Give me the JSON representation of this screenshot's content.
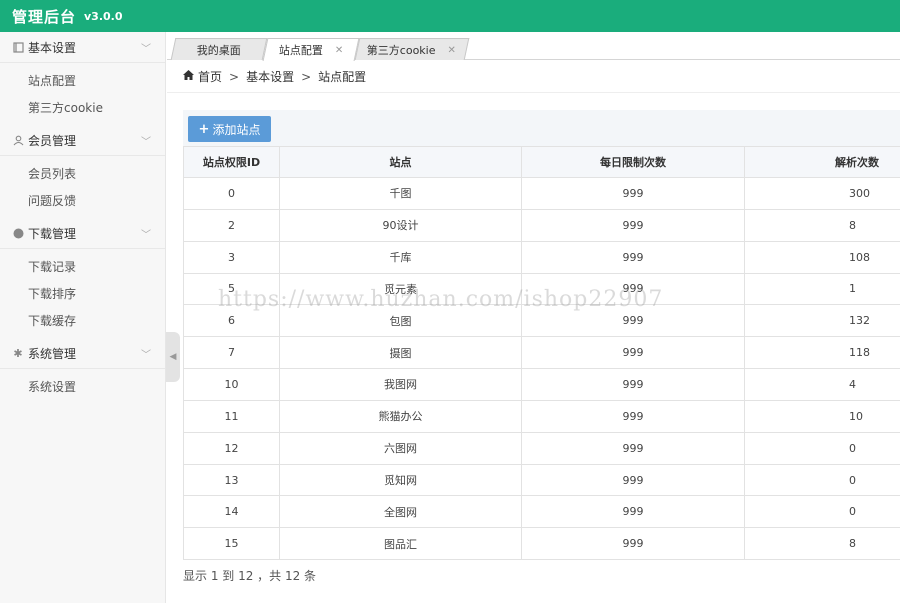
{
  "header": {
    "title": "管理后台",
    "version": "v3.0.0"
  },
  "sidebar": {
    "groups": [
      {
        "label": "基本设置",
        "icon": "book-icon",
        "items": [
          "站点配置",
          "第三方cookie"
        ]
      },
      {
        "label": "会员管理",
        "icon": "user-icon",
        "items": [
          "会员列表",
          "问题反馈"
        ]
      },
      {
        "label": "下载管理",
        "icon": "download-icon",
        "items": [
          "下载记录",
          "下载排序",
          "下载缓存"
        ]
      },
      {
        "label": "系统管理",
        "icon": "gear-icon",
        "items": [
          "系统设置"
        ]
      }
    ]
  },
  "tabs": [
    {
      "label": "我的桌面",
      "closable": false,
      "active": false
    },
    {
      "label": "站点配置",
      "closable": true,
      "active": true
    },
    {
      "label": "第三方cookie",
      "closable": true,
      "active": false
    }
  ],
  "breadcrumb": {
    "home": "首页",
    "level1": "基本设置",
    "level2": "站点配置",
    "separator": ">"
  },
  "toolbar": {
    "add_label": "添加站点"
  },
  "table": {
    "columns": [
      "站点权限ID",
      "站点",
      "每日限制次数",
      "解析次数"
    ],
    "rows": [
      [
        "0",
        "千图",
        "999",
        "300"
      ],
      [
        "2",
        "90设计",
        "999",
        "8"
      ],
      [
        "3",
        "千库",
        "999",
        "108"
      ],
      [
        "5",
        "觅元素",
        "999",
        "1"
      ],
      [
        "6",
        "包图",
        "999",
        "132"
      ],
      [
        "7",
        "摄图",
        "999",
        "118"
      ],
      [
        "10",
        "我图网",
        "999",
        "4"
      ],
      [
        "11",
        "熊猫办公",
        "999",
        "10"
      ],
      [
        "12",
        "六图网",
        "999",
        "0"
      ],
      [
        "13",
        "觅知网",
        "999",
        "0"
      ],
      [
        "14",
        "全图网",
        "999",
        "0"
      ],
      [
        "15",
        "图品汇",
        "999",
        "8"
      ]
    ]
  },
  "pagination": {
    "info": "显示 1 到 12 ，共 12 条"
  },
  "watermark": "https://www.huzhan.com/ishop22907",
  "colors": {
    "header_bg": "#1aad7c",
    "button_bg": "#5b9bd8"
  }
}
